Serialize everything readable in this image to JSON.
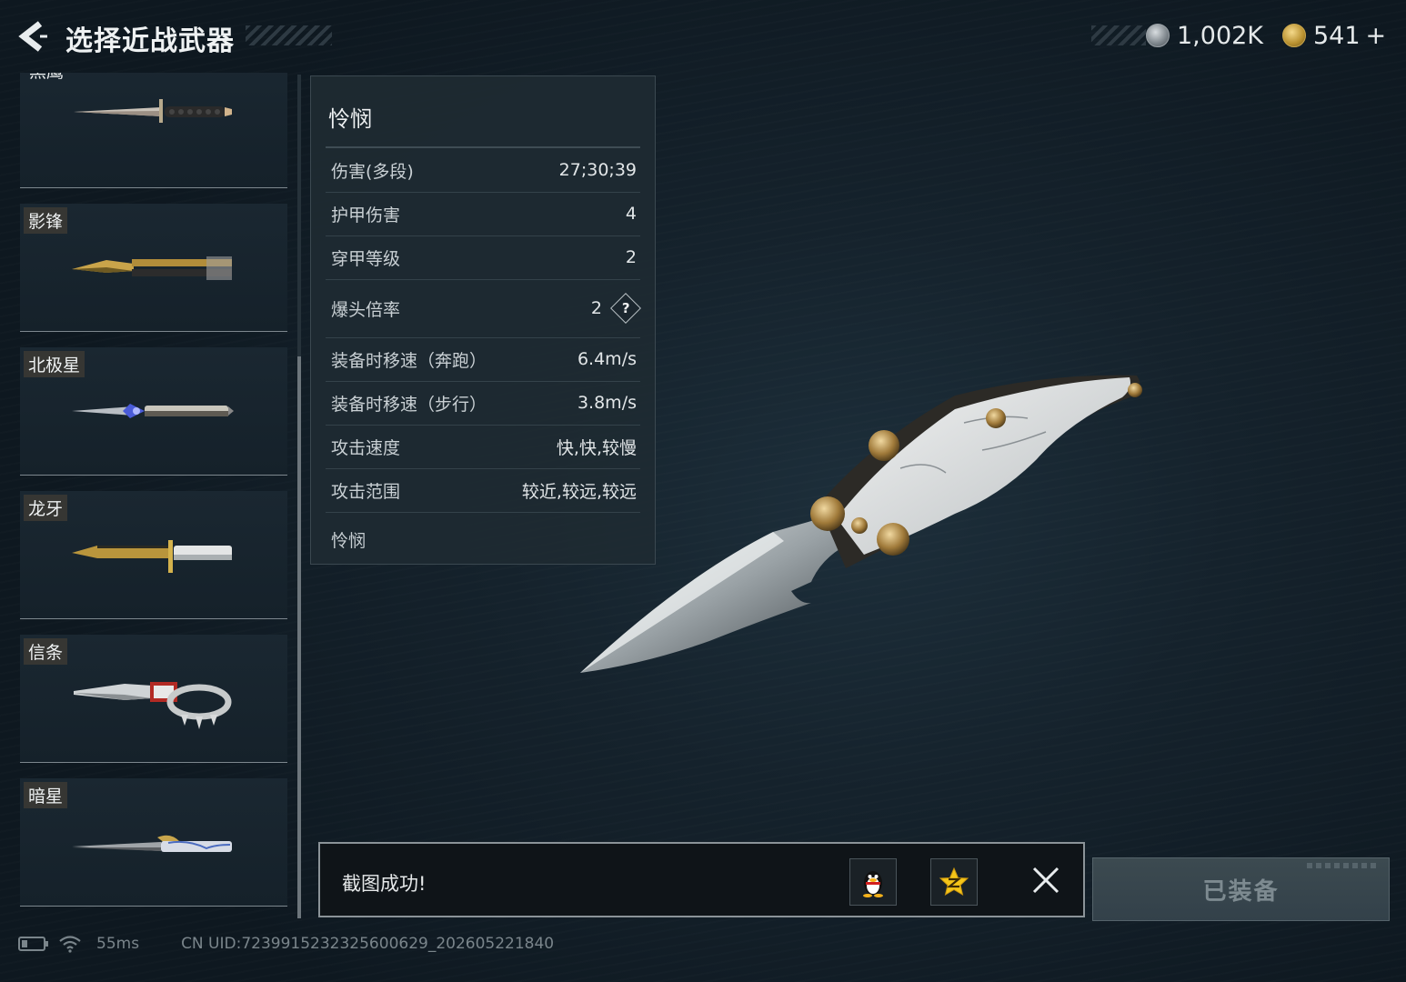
{
  "header": {
    "title": "选择近战武器"
  },
  "currency": {
    "silver": "1,002K",
    "gold": "541",
    "gold_add": "+"
  },
  "weapon_list": [
    {
      "name": "黑鹰",
      "partial": true
    },
    {
      "name": "影锋"
    },
    {
      "name": "北极星"
    },
    {
      "name": "龙牙"
    },
    {
      "name": "信条"
    },
    {
      "name": "暗星"
    }
  ],
  "stats_panel": {
    "title": "怜悯",
    "rows": [
      {
        "label": "伤害(多段)",
        "value": "27;30;39"
      },
      {
        "label": "护甲伤害",
        "value": "4"
      },
      {
        "label": "穿甲等级",
        "value": "2"
      },
      {
        "label": "爆头倍率",
        "value": "2"
      },
      {
        "label": "装备时移速（奔跑）",
        "value": "6.4m/s"
      },
      {
        "label": "装备时移速（步行）",
        "value": "3.8m/s"
      },
      {
        "label": "攻击速度",
        "value": "快,快,较慢"
      },
      {
        "label": "攻击范围",
        "value": "较近,较远,较远"
      }
    ],
    "help_glyph": "?",
    "description": "怜悯"
  },
  "toast": {
    "message": "截图成功!",
    "share_qq_icon": "qq-penguin-icon",
    "share_qzone_icon": "qzone-star-icon",
    "close_icon": "close-icon"
  },
  "equip_button": {
    "label": "已装备"
  },
  "status_bar": {
    "ping": "55ms",
    "uid": "CN UID:7239915232325600629_202605221840"
  },
  "colors": {
    "background": "#15222c",
    "panel": "#1e2a32",
    "accent_gold": "#c9a64c"
  }
}
